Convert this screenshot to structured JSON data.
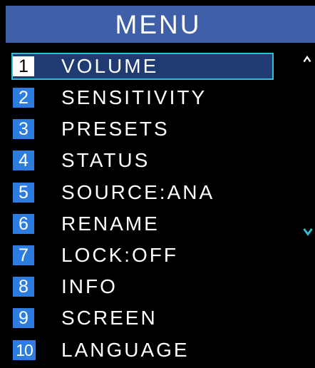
{
  "header": {
    "title": "MENU"
  },
  "menu": {
    "selected_index": 0,
    "items": [
      {
        "number": "1",
        "label": "VOLUME"
      },
      {
        "number": "2",
        "label": "SENSITIVITY"
      },
      {
        "number": "3",
        "label": "PRESETS"
      },
      {
        "number": "4",
        "label": "STATUS"
      },
      {
        "number": "5",
        "label": "SOURCE:ANA"
      },
      {
        "number": "6",
        "label": "RENAME"
      },
      {
        "number": "7",
        "label": "LOCK:OFF"
      },
      {
        "number": "8",
        "label": "INFO"
      },
      {
        "number": "9",
        "label": "SCREEN"
      },
      {
        "number": "10",
        "label": "LANGUAGE"
      }
    ]
  },
  "scroll": {
    "up_icon": "chevron-up-icon",
    "down_icon": "chevron-down-icon"
  },
  "colors": {
    "header_bg": "#3f5fa8",
    "number_badge": "#2d7de0",
    "selection_border": "#2ac0d8",
    "scroll_down_arrow": "#2ac0d8",
    "text": "#ffffff",
    "background": "#000000"
  }
}
